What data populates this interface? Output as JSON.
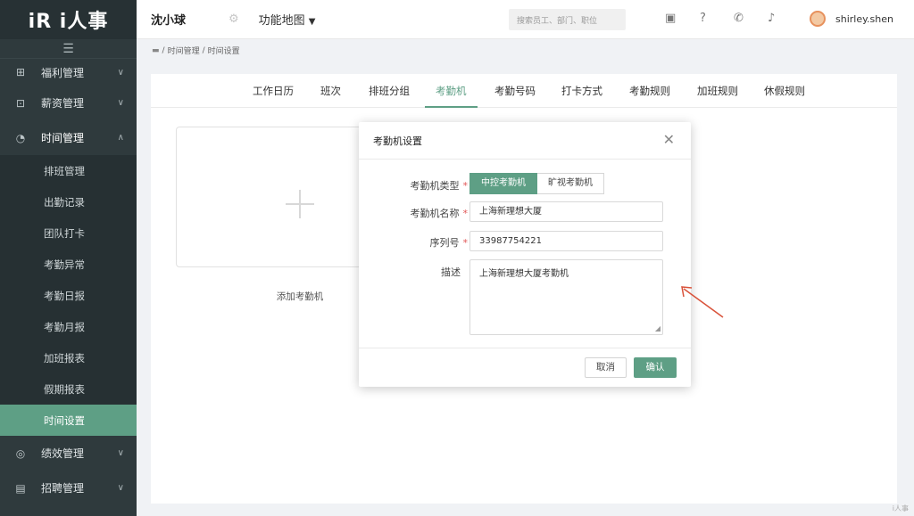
{
  "sidebar": {
    "logo": "iR i人事",
    "hamburger": "☰",
    "groups_top": [
      {
        "label": "福利管理",
        "icon": "gift-icon"
      },
      {
        "label": "薪资管理",
        "icon": "wallet-icon"
      },
      {
        "label": "时间管理",
        "icon": "clock-icon"
      }
    ],
    "sub_items": [
      "排班管理",
      "出勤记录",
      "团队打卡",
      "考勤异常",
      "考勤日报",
      "考勤月报",
      "加班报表",
      "假期报表",
      "时间设置"
    ],
    "groups_bottom": [
      {
        "label": "绩效管理",
        "icon": "target-icon"
      },
      {
        "label": "招聘管理",
        "icon": "clipboard-icon"
      }
    ]
  },
  "header": {
    "company": "沈小球",
    "function_map": "功能地图",
    "search_placeholder": "搜索员工、部门、职位",
    "username": "shirley.shen"
  },
  "breadcrumb": {
    "level1": "时间管理",
    "level2": "时间设置"
  },
  "tabs": [
    "工作日历",
    "班次",
    "排班分组",
    "考勤机",
    "考勤号码",
    "打卡方式",
    "考勤规则",
    "加班规则",
    "休假规则"
  ],
  "active_tab": "考勤机",
  "add_card": {
    "label": "添加考勤机"
  },
  "modal": {
    "title": "考勤机设置",
    "type_label": "考勤机类型",
    "type_options": [
      "中控考勤机",
      "旷视考勤机"
    ],
    "selected_type": "中控考勤机",
    "name_label": "考勤机名称",
    "name_value": "上海新理想大厦",
    "serial_label": "序列号",
    "serial_value": "33987754221",
    "desc_label": "描述",
    "desc_value": "上海新理想大厦考勤机",
    "cancel": "取消",
    "confirm": "确认"
  },
  "watermark": "i人事",
  "colors": {
    "accent": "#5e9f85",
    "sidebar": "#2f3a3d",
    "required": "#e15656",
    "arrow": "#d9533b"
  }
}
